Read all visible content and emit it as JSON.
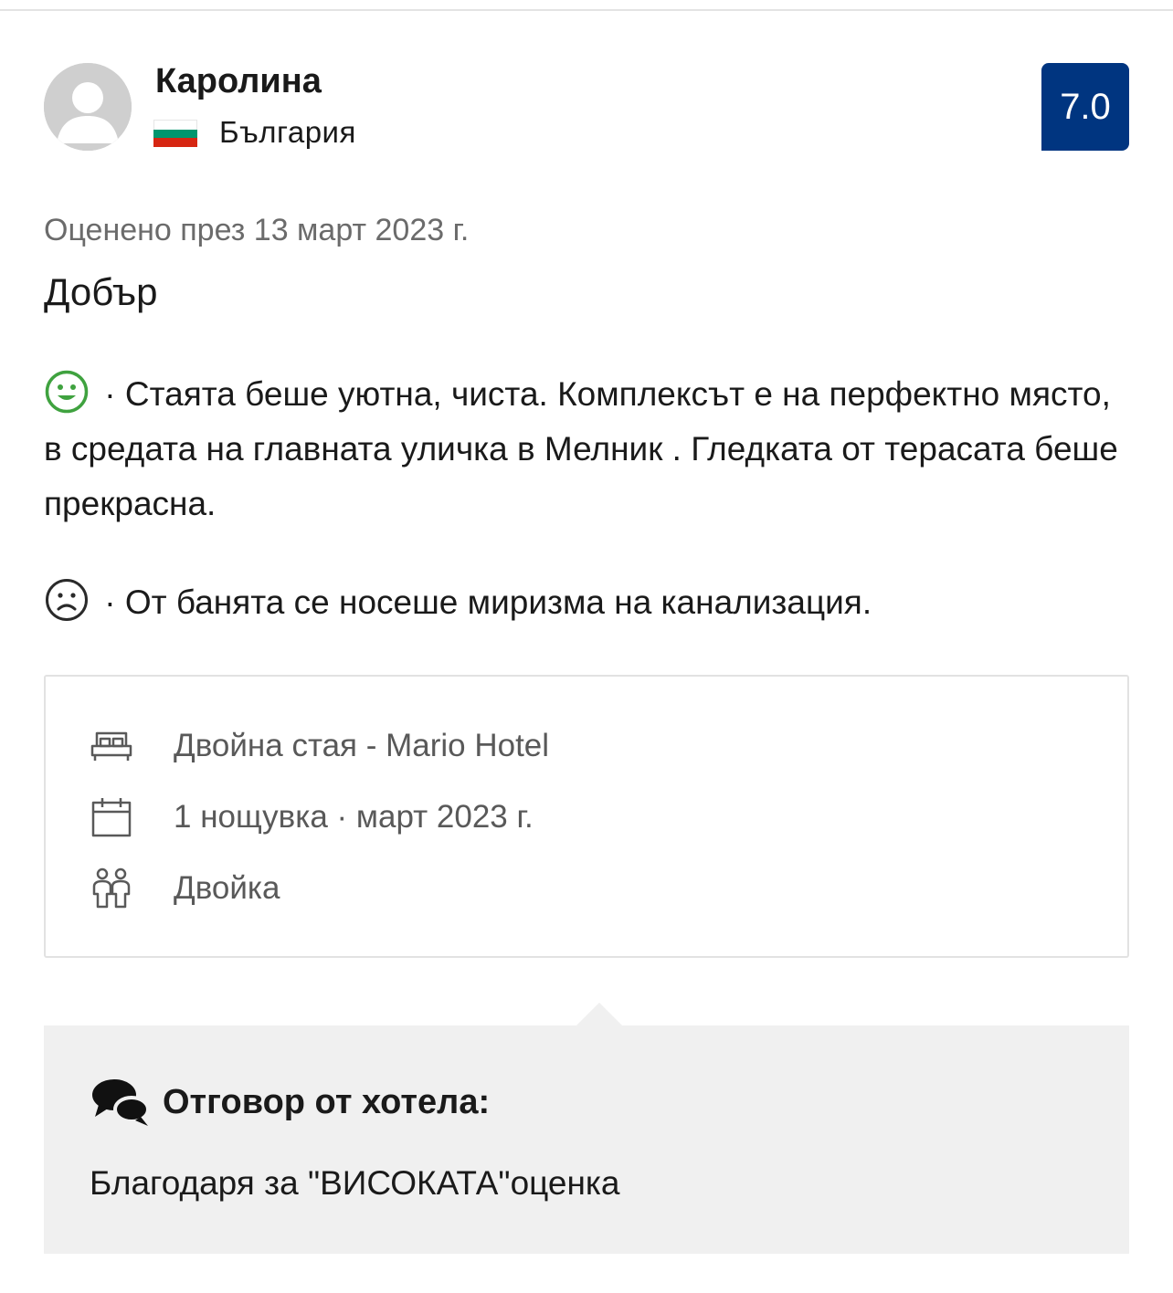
{
  "reviewer": {
    "name": "Каролина",
    "country": "България",
    "avatar_icon": "user-avatar-icon",
    "flag_icon": "bulgaria-flag-icon",
    "flag_colors": [
      "#ffffff",
      "#00966e",
      "#d62612"
    ]
  },
  "score": {
    "value": "7.0",
    "color": "#003580"
  },
  "review": {
    "date": "Оценено през 13 март 2023 г.",
    "title": "Добър",
    "positive_icon": "happy-face-icon",
    "positive_color": "#3fa23f",
    "positive_text": " · Стаята беше уютна, чиста. Комплексът е на перфектно място, в средата на главната уличка в Мелник . Гледката от терасата беше прекрасна.",
    "negative_icon": "sad-face-icon",
    "negative_text": " · От банята се носеше миризма на канализация."
  },
  "stay": {
    "room": {
      "icon": "bed-icon",
      "text": "Двойна стая - Mario Hotel"
    },
    "nights": {
      "icon": "calendar-icon",
      "text": "1 нощувка · март 2023 г."
    },
    "group": {
      "icon": "people-icon",
      "text": "Двойка"
    }
  },
  "reply": {
    "icon": "chat-bubbles-icon",
    "heading": "Отговор от хотела:",
    "text": "Благодаря за \"ВИСОКАТА\"оценка"
  }
}
